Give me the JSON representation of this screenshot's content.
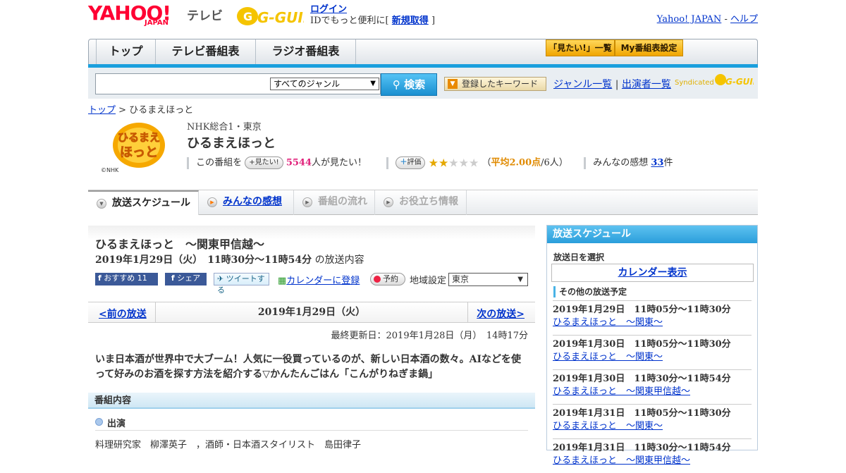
{
  "header": {
    "yahoo": "YAHOO!",
    "yahoo_sub": "JAPAN",
    "tv": "テレビ",
    "gguide": "G-GUIDE",
    "login": "ログイン",
    "login_text_pre": "IDでもっと便利に[",
    "signup": "新規取得",
    "login_text_post": "]",
    "yahoo_japan": "Yahoo! JAPAN",
    "sep": "-",
    "help": "ヘルプ"
  },
  "nav": {
    "tabs": [
      "トップ",
      "テレビ番組表",
      "ラジオ番組表"
    ],
    "mitai_list": "「見たい!」一覧",
    "my_settings": "My番組表設定"
  },
  "search": {
    "genre": "すべてのジャンル",
    "button": "検索",
    "keyword_btn": "登録したキーワード",
    "genre_list": "ジャンル一覧",
    "divider": "|",
    "performer_list": "出演者一覧",
    "syndicated": "Syndicated",
    "synd_logo": "G-GUIDE"
  },
  "breadcrumb": {
    "top": "トップ",
    "sep": " > ",
    "current": "ひるまえほっと"
  },
  "program": {
    "logo_text": [
      "ひるまえ",
      "ほっと"
    ],
    "copyright": "©NHK",
    "channel": "NHK総合1・東京",
    "title": "ひるまえほっと",
    "mitai_pre": "この番組を",
    "mitai_btn": "見たい!",
    "mitai_count": "5544",
    "mitai_post": "人が見たい！",
    "rate_btn": "評価",
    "rating": 2,
    "rating_max": 5,
    "avg_open": "（",
    "avg_label": "平均2.00点",
    "avg_post": "/6人）",
    "reviews_label": "みんなの感想",
    "reviews_count": "33",
    "reviews_unit": "件"
  },
  "tabs": [
    "放送スケジュール",
    "みんなの感想",
    "番組の流れ",
    "お役立ち情報"
  ],
  "episode": {
    "title": "ひるまえほっと　～関東甲信越～",
    "time": "2019年1月29日（火）　11時30分～11時54分",
    "time_suffix": "の放送内容",
    "fb_recommend": "おすすめ 11",
    "fb_share": "シェア",
    "tweet": "ツイートする",
    "calendar_register": "カレンダーに登録",
    "reserve": "予約",
    "region_label": "地域設定",
    "region": "東京"
  },
  "pager": {
    "prev": "<前の放送",
    "date": "2019年1月29日（火）",
    "next": "次の放送>"
  },
  "updated": "最終更新日：2019年1月28日（月）　14時17分",
  "description": "いま日本酒が世界中で大ブーム！人気に一役買っているのが、新しい日本酒の数々。AIなどを使って好みのお酒を探す方法を紹介する▽かんたんごはん「こんがりねぎま鍋」",
  "content_section": "番組内容",
  "cast_label": "出演",
  "cast": "料理研究家　柳澤英子　，酒師・日本酒スタイリスト　島田律子",
  "side": {
    "title": "放送スケジュール",
    "select_date": "放送日を選択",
    "calendar": "カレンダー表示",
    "other": "その他の放送予定",
    "items": [
      {
        "date": "2019年1月29日　11時05分～11時30分",
        "link": "ひるまえほっと　～関東～"
      },
      {
        "date": "2019年1月30日　11時05分～11時30分",
        "link": "ひるまえほっと　～関東～"
      },
      {
        "date": "2019年1月30日　11時30分～11時54分",
        "link": "ひるまえほっと　～関東甲信越～"
      },
      {
        "date": "2019年1月31日　11時05分～11時30分",
        "link": "ひるまえほっと　～関東～"
      },
      {
        "date": "2019年1月31日　11時30分～11時54分",
        "link": "ひるまえほっと　～関東甲信越～"
      }
    ]
  },
  "colors": {
    "brand_red": "#ff0033",
    "accent_blue": "#1a9fdd",
    "link": "#0033cc",
    "mitai_pink": "#e0207a",
    "avg_orange": "#e08a00"
  }
}
